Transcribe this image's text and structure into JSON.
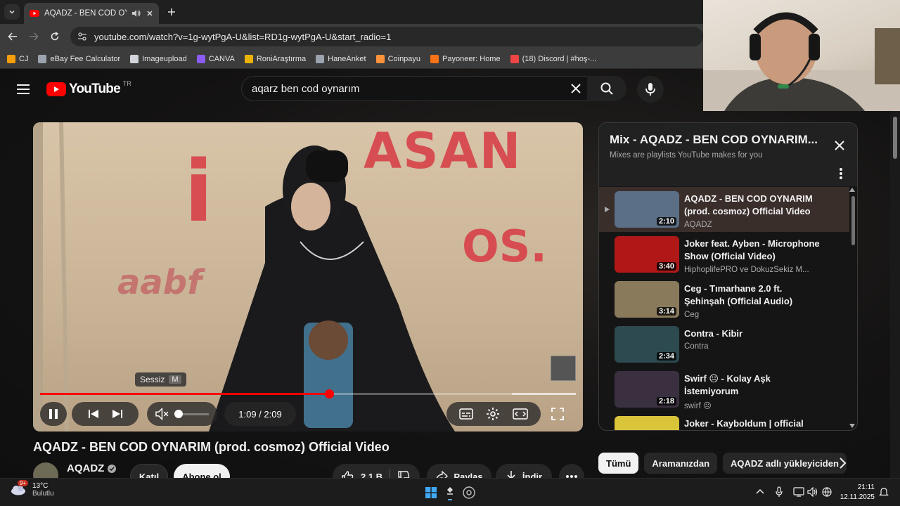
{
  "browser": {
    "tab_title": "AQADZ - BEN COD OYNARIM",
    "url": "youtube.com/watch?v=1g-wytPgA-U&list=RD1g-wytPgA-U&start_radio=1",
    "bookmarks": [
      {
        "label": "CJ",
        "color": "#f59e0b"
      },
      {
        "label": "eBay Fee Calculator",
        "color": "#9ca3af"
      },
      {
        "label": "Imageupload",
        "color": "#d1d5db"
      },
      {
        "label": "CANVA",
        "color": "#8b5cf6"
      },
      {
        "label": "RoniAraştırma",
        "color": "#eab308"
      },
      {
        "label": "HaneAnket",
        "color": "#9ca3af"
      },
      {
        "label": "Coinpayu",
        "color": "#fb923c"
      },
      {
        "label": "Payoneer: Home",
        "color": "#f97316"
      },
      {
        "label": "(18) Discord | #hoş-...",
        "color": "#ef4444"
      }
    ]
  },
  "youtube": {
    "logo_text": "YouTube",
    "country_code": "TR",
    "search_query": "aqarz ben cod oynarım",
    "accent": "#ff0000"
  },
  "player": {
    "graffiti": [
      "i",
      "ASAN",
      "OS.",
      "aabf"
    ],
    "progress": 0.54,
    "buffered_from": 0.88,
    "buffered_to": 1.0,
    "time_current": "1:09",
    "time_total": "2:09",
    "time_display": "1:09 / 2:09",
    "mute_tooltip": "Sessiz",
    "mute_key": "M"
  },
  "video": {
    "title": "AQADZ - BEN COD OYNARIM (prod. cosmoz) Official Video",
    "channel": "AQADZ",
    "join_label": "Katıl",
    "subscribe_label": "Abone ol",
    "likes": "2,1 B",
    "share_label": "Paylaş",
    "download_label": "İndir"
  },
  "playlist": {
    "title": "Mix - AQADZ - BEN COD OYNARIM...",
    "subtitle": "Mixes are playlists YouTube makes for you",
    "items": [
      {
        "title": "AQADZ - BEN COD OYNARIM (prod. cosmoz) Official Video",
        "channel": "AQADZ",
        "duration": "2:10",
        "active": true,
        "thumb": "#5b6f86"
      },
      {
        "title": "Joker feat. Ayben - Microphone Show (Official Video)",
        "channel": "HiphoplifePRO ve DokuzSekiz M...",
        "duration": "3:40",
        "active": false,
        "thumb": "#b01818"
      },
      {
        "title": "Ceg - Tımarhane 2.0 ft. Şehinşah (Official Audio)",
        "channel": "Ceg",
        "duration": "3:14",
        "active": false,
        "thumb": "#8a7a5c"
      },
      {
        "title": "Contra - Kibir",
        "channel": "Contra",
        "duration": "2:34",
        "active": false,
        "thumb": "#2c4a50"
      },
      {
        "title": "Swirf ☹ - Kolay Aşk İstemiyorum",
        "channel": "swirf ☹",
        "duration": "2:18",
        "active": false,
        "thumb": "#3a3040"
      },
      {
        "title": "Joker - Kayboldum | official video",
        "channel": "",
        "duration": "",
        "active": false,
        "thumb": "#d9c43a"
      }
    ]
  },
  "chips": [
    "Tümü",
    "Aramanızdan",
    "AQADZ adlı yükleyiciden"
  ],
  "taskbar": {
    "temp": "13°C",
    "weather": "Bulutlu",
    "weather_badge": "9+",
    "time": "21:11",
    "date": "12.11.2025"
  }
}
